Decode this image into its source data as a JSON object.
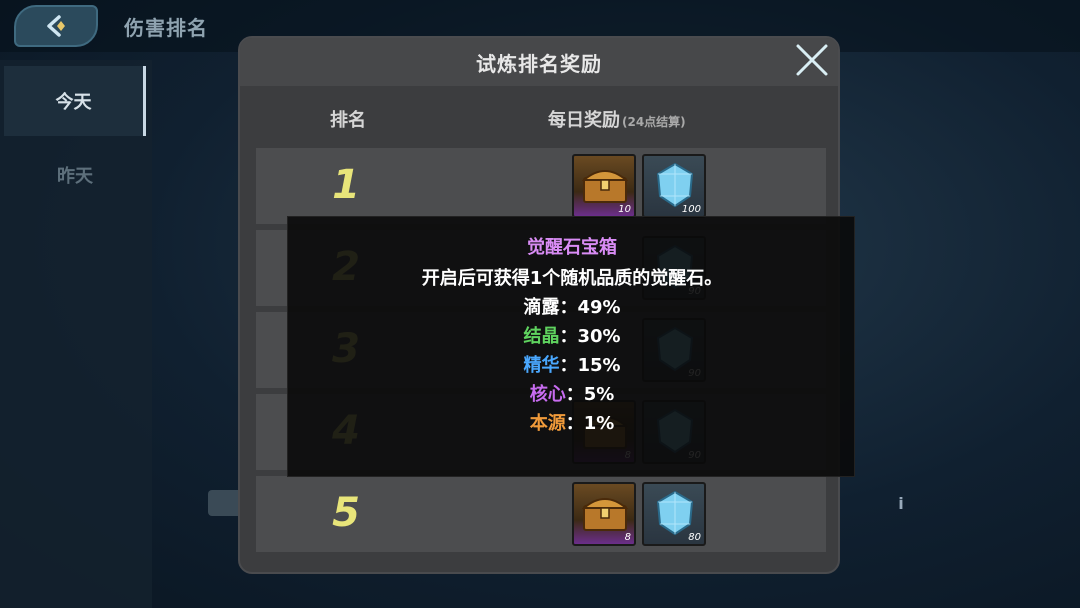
{
  "screen": {
    "title": "伤害排名",
    "tabs": [
      "今天",
      "昨天"
    ]
  },
  "dialog": {
    "title": "试炼排名奖励",
    "columns": {
      "rank": "排名",
      "reward": "每日奖励",
      "reward_note": "(24点结算)"
    },
    "rows": [
      {
        "rank": "1",
        "chest_qty": "10",
        "gem_qty": "100"
      },
      {
        "rank": "2",
        "chest_qty": "",
        "gem_qty": "90"
      },
      {
        "rank": "3",
        "chest_qty": "",
        "gem_qty": "90"
      },
      {
        "rank": "4",
        "chest_qty": "8",
        "gem_qty": "90"
      },
      {
        "rank": "5",
        "chest_qty": "8",
        "gem_qty": "80"
      }
    ]
  },
  "tooltip": {
    "title": "觉醒石宝箱",
    "description": "开启后可获得1个随机品质的觉醒石。",
    "qualities": [
      {
        "name": "滴露",
        "value": "：49%",
        "color": "#ffffff"
      },
      {
        "name": "结晶",
        "value": "：30%",
        "color": "#5fd35f"
      },
      {
        "name": "精华",
        "value": "：15%",
        "color": "#4aa8ff"
      },
      {
        "name": "核心",
        "value": "：5%",
        "color": "#c86cf0"
      },
      {
        "name": "本源",
        "value": "：1%",
        "color": "#f09a3a"
      }
    ]
  },
  "colors": {
    "rank_number": "#e8e57a",
    "tooltip_title": "#d98cf5"
  }
}
